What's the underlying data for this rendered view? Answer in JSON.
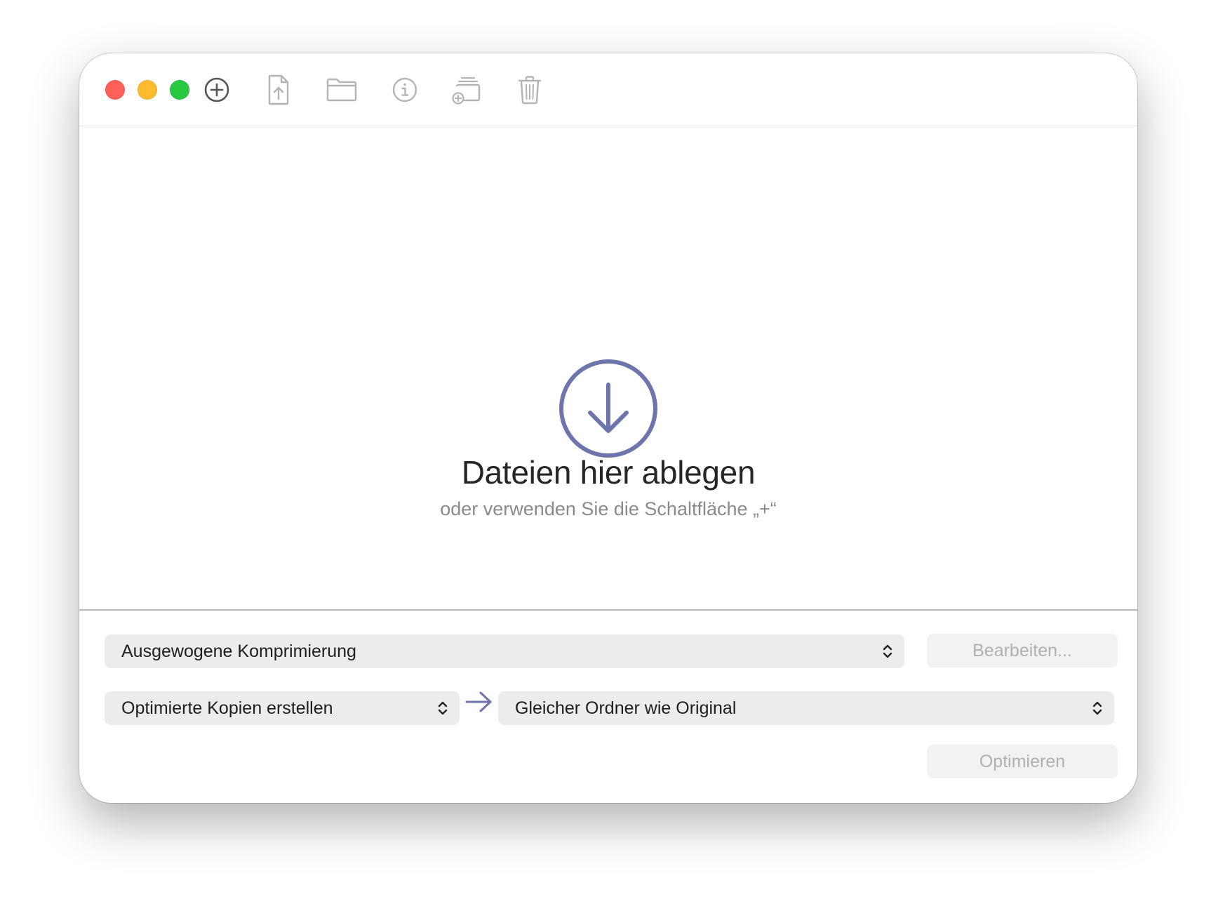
{
  "window": {
    "controls": [
      "close",
      "minimize",
      "zoom"
    ]
  },
  "toolbar": {
    "items": [
      {
        "icon": "plus-circle-icon",
        "enabled": true
      },
      {
        "icon": "file-upload-icon",
        "enabled": false
      },
      {
        "icon": "folder-icon",
        "enabled": false
      },
      {
        "icon": "info-circle-icon",
        "enabled": false
      },
      {
        "icon": "add-to-stack-icon",
        "enabled": false
      },
      {
        "icon": "trash-icon",
        "enabled": false
      }
    ]
  },
  "dropzone": {
    "title": "Dateien hier ablegen",
    "subtitle": "oder verwenden Sie die Schaltfläche „+“",
    "icon": "download-circle-icon",
    "accent": "#6e75ad"
  },
  "settings": {
    "preset": "Ausgewogene Komprimierung",
    "edit_button": "Bearbeiten...",
    "mode": "Optimierte Kopien erstellen",
    "destination": "Gleicher Ordner wie Original",
    "optimize_button": "Optimieren"
  }
}
